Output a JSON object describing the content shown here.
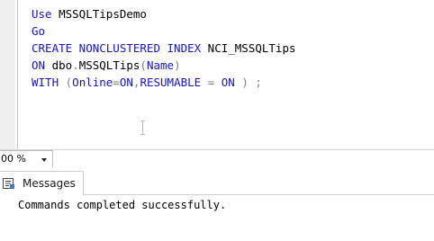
{
  "editor": {
    "lines": [
      {
        "parts": [
          {
            "t": "Use ",
            "c": "kw"
          },
          {
            "t": "MSSQLTipsDemo",
            "c": ""
          }
        ]
      },
      {
        "parts": [
          {
            "t": "Go",
            "c": "kw"
          }
        ]
      },
      {
        "parts": [
          {
            "t": "CREATE NONCLUSTERED INDEX ",
            "c": "kw"
          },
          {
            "t": "NCI_MSSQLTips",
            "c": ""
          }
        ]
      },
      {
        "parts": [
          {
            "t": "ON ",
            "c": "kw"
          },
          {
            "t": "dbo",
            "c": ""
          },
          {
            "t": ".",
            "c": "gray"
          },
          {
            "t": "MSSQLTips",
            "c": ""
          },
          {
            "t": "(",
            "c": "gray"
          },
          {
            "t": "Name",
            "c": "kw"
          },
          {
            "t": ")",
            "c": "gray"
          }
        ]
      },
      {
        "parts": [
          {
            "t": "WITH ",
            "c": "kw"
          },
          {
            "t": "(",
            "c": "gray"
          },
          {
            "t": "Online",
            "c": "kw"
          },
          {
            "t": "=",
            "c": "gray"
          },
          {
            "t": "ON",
            "c": "kw"
          },
          {
            "t": ",",
            "c": "gray"
          },
          {
            "t": "RESUMABLE ",
            "c": "kw"
          },
          {
            "t": "= ",
            "c": "gray"
          },
          {
            "t": "ON ",
            "c": "kw"
          },
          {
            "t": ") ;",
            "c": "gray"
          }
        ]
      }
    ]
  },
  "statusbar": {
    "zoom_value": "00 %"
  },
  "results": {
    "tab_label": "Messages",
    "message": "Commands completed successfully."
  },
  "colors": {
    "keyword": "#1414d2",
    "operator": "#7f7f7f",
    "margin_indicator": "#e3c95b"
  }
}
